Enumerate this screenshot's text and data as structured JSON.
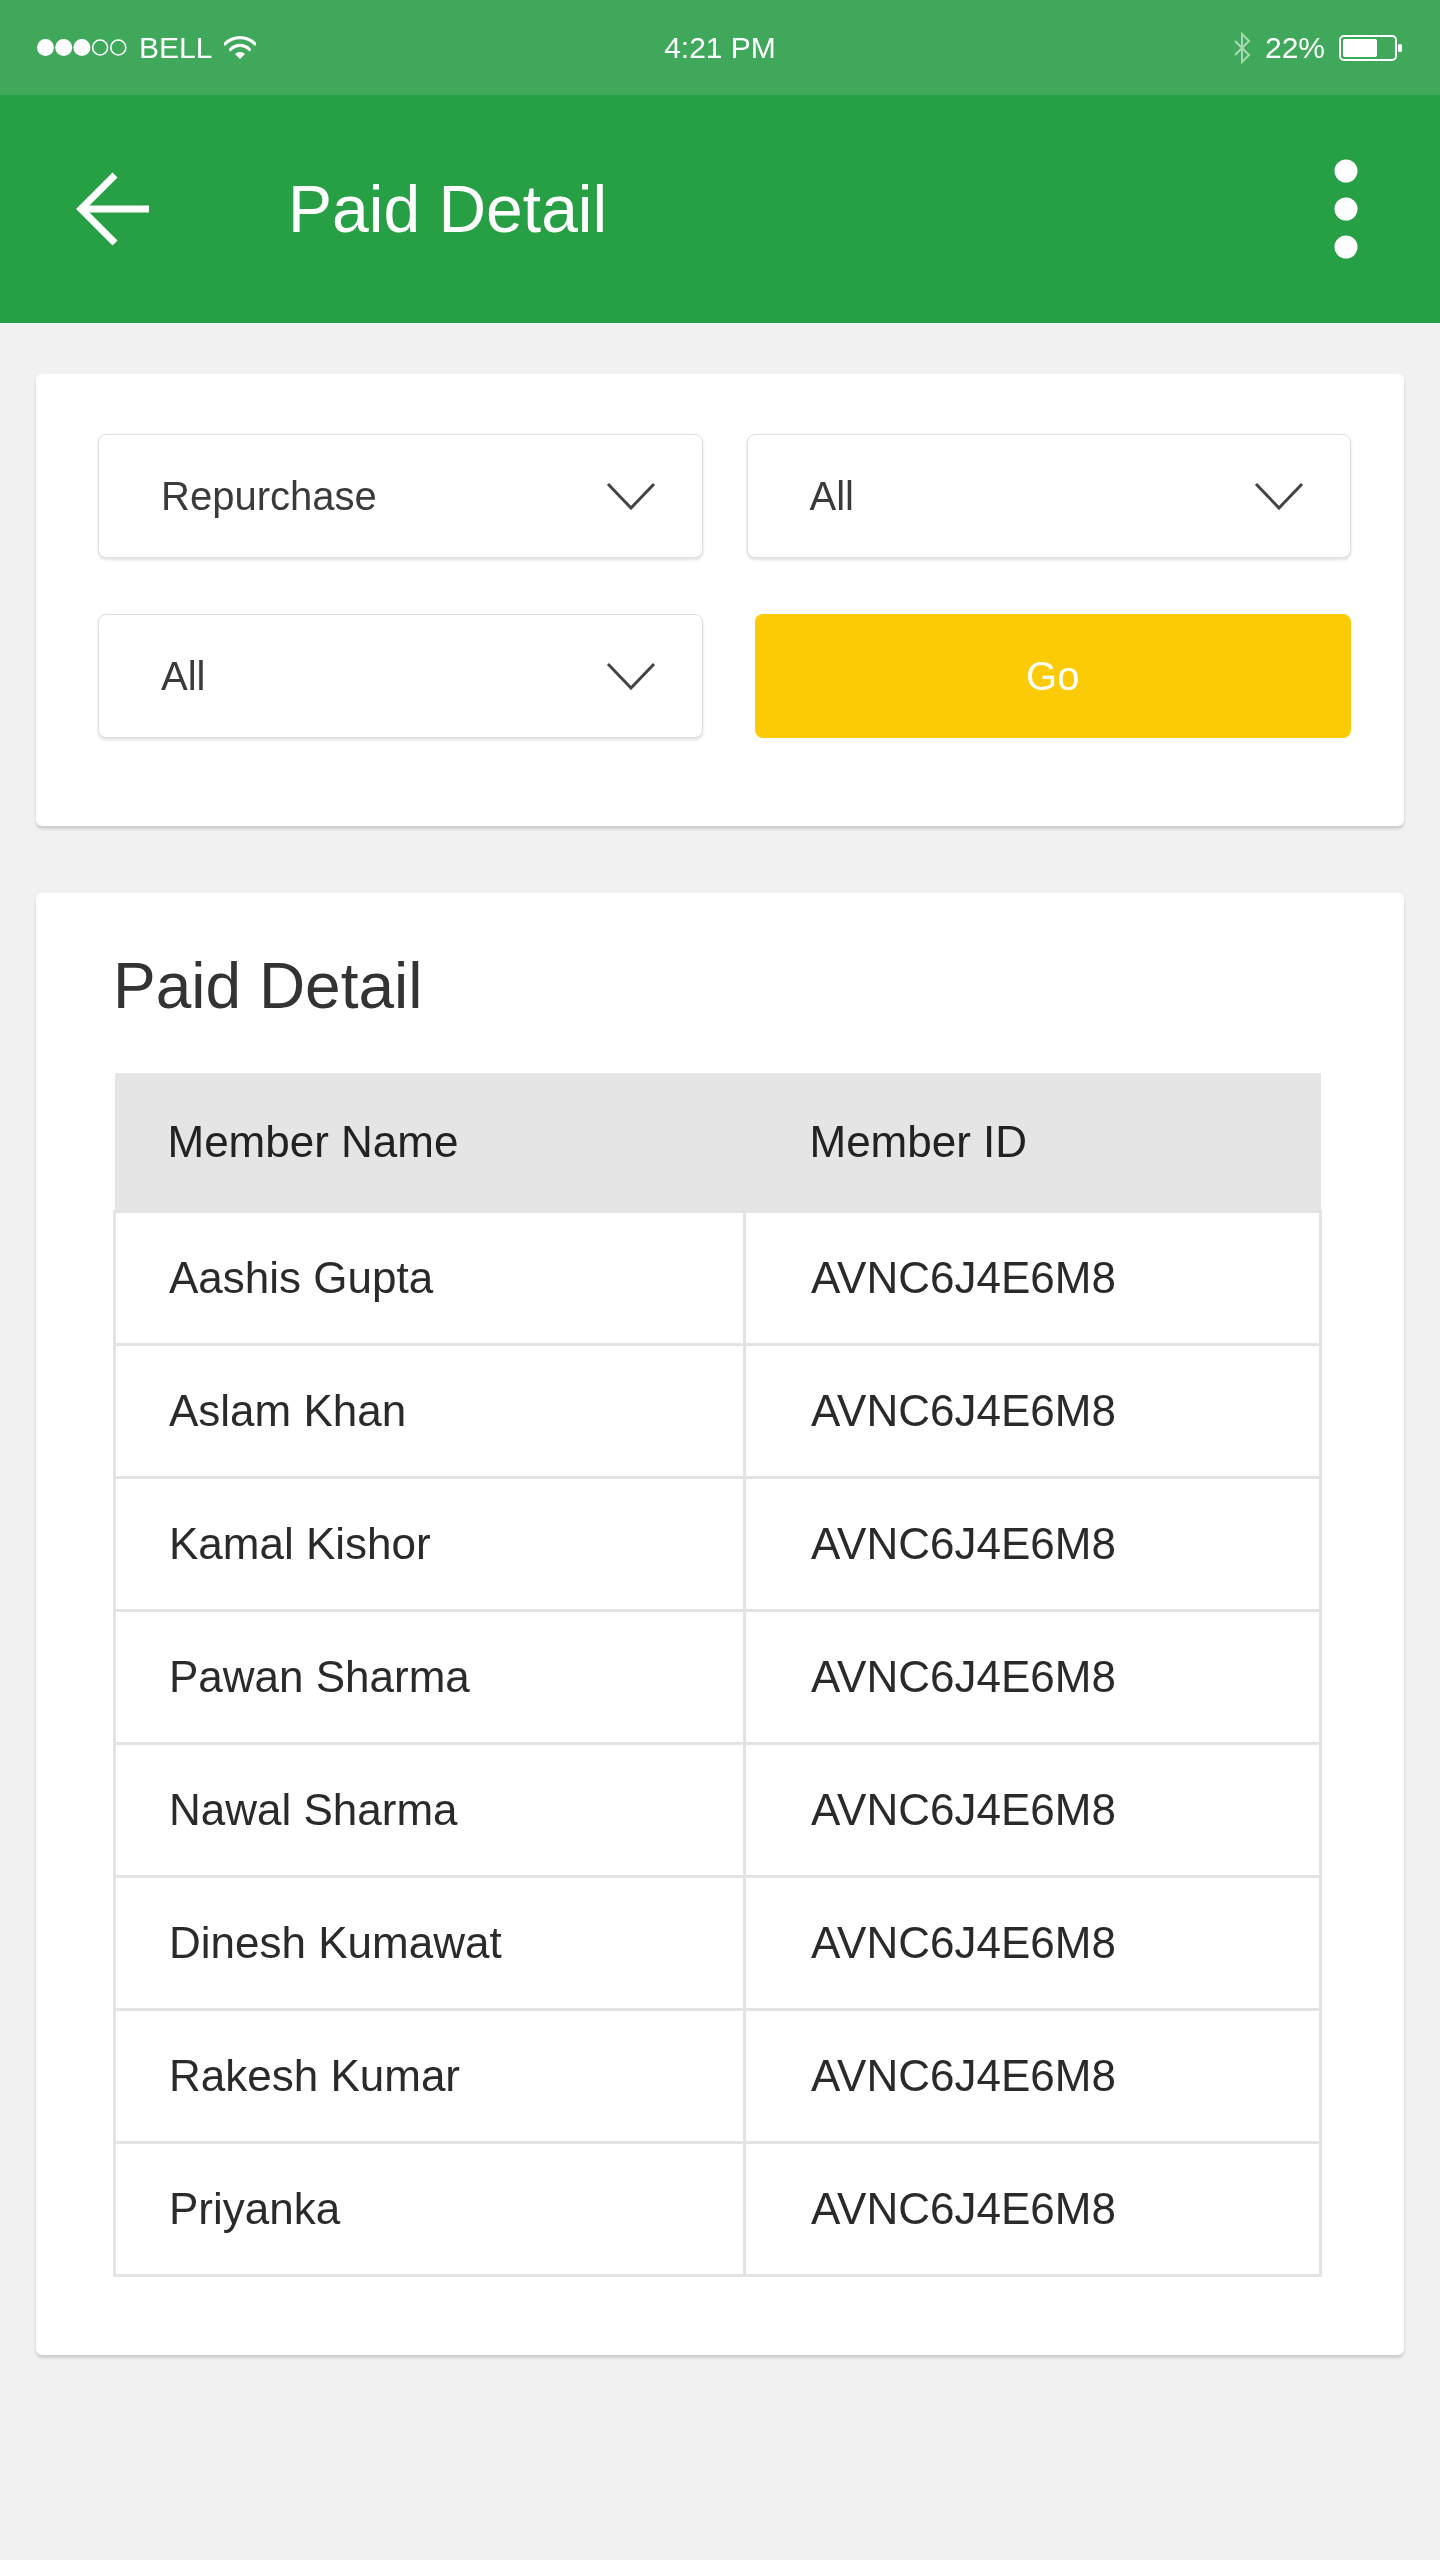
{
  "status_bar": {
    "carrier": "BELL",
    "time": "4:21 PM",
    "battery": "22%"
  },
  "app_bar": {
    "title": "Paid Detail"
  },
  "filters": {
    "dropdowns": [
      {
        "value": "Repurchase"
      },
      {
        "value": "All"
      },
      {
        "value": "All"
      }
    ],
    "go_button": "Go"
  },
  "paid_detail": {
    "title": "Paid Detail",
    "table": {
      "columns": [
        "Member Name",
        "Member ID"
      ],
      "rows": [
        [
          "Aashis Gupta",
          "AVNC6J4E6M8"
        ],
        [
          "Aslam Khan",
          "AVNC6J4E6M8"
        ],
        [
          "Kamal Kishor",
          "AVNC6J4E6M8"
        ],
        [
          "Pawan Sharma",
          "AVNC6J4E6M8"
        ],
        [
          "Nawal Sharma",
          "AVNC6J4E6M8"
        ],
        [
          "Dinesh Kumawat",
          "AVNC6J4E6M8"
        ],
        [
          "Rakesh Kumar",
          "AVNC6J4E6M8"
        ],
        [
          "Priyanka",
          "AVNC6J4E6M8"
        ]
      ]
    }
  }
}
